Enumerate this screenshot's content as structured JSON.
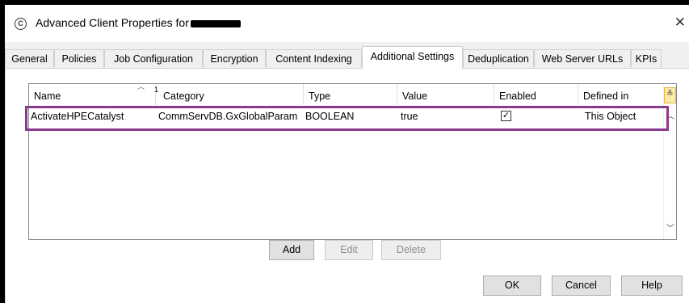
{
  "window": {
    "title": "Advanced Client Properties for",
    "title_icon": "commvault-logo-icon",
    "close_icon": "close-icon",
    "close_glyph": "✕"
  },
  "tabs": [
    {
      "label": "General",
      "active": false
    },
    {
      "label": "Policies",
      "active": false
    },
    {
      "label": "Job Configuration",
      "active": false
    },
    {
      "label": "Encryption",
      "active": false
    },
    {
      "label": "Content Indexing",
      "active": false
    },
    {
      "label": "Additional Settings",
      "active": true
    },
    {
      "label": "Deduplication",
      "active": false
    },
    {
      "label": "Web Server URLs",
      "active": false
    },
    {
      "label": "KPIs",
      "active": false
    }
  ],
  "table": {
    "columns": [
      "Name",
      "Category",
      "Type",
      "Value",
      "Enabled",
      "Defined in"
    ],
    "sort_indicator": "1",
    "rows": [
      {
        "name": "ActivateHPECatalyst",
        "category": "CommServDB.GxGlobalParam",
        "type": "BOOLEAN",
        "value": "true",
        "enabled": true,
        "defined_in": "This Object"
      }
    ]
  },
  "buttons": {
    "add": "Add",
    "edit": "Edit",
    "delete": "Delete",
    "ok": "OK",
    "cancel": "Cancel",
    "help": "Help"
  },
  "colors": {
    "highlight_border": "#8a3a8c"
  }
}
